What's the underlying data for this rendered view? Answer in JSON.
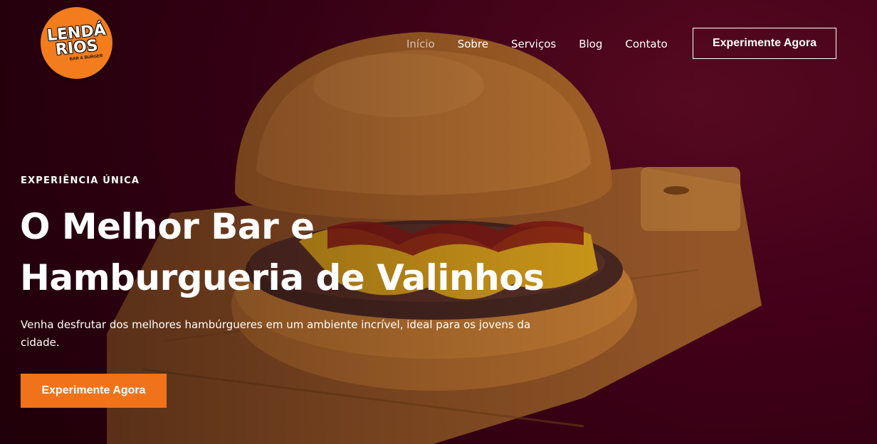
{
  "brand": {
    "logo_line1": "LENDÁ",
    "logo_line2": "RIOS",
    "logo_tagline": "BAR & BURGER",
    "logo_color": "#f37d1c"
  },
  "nav": {
    "items": [
      {
        "label": "Início",
        "active": true
      },
      {
        "label": "Sobre",
        "active": false
      },
      {
        "label": "Serviços",
        "active": false
      },
      {
        "label": "Blog",
        "active": false
      },
      {
        "label": "Contato",
        "active": false
      }
    ],
    "cta_label": "Experimente Agora"
  },
  "hero": {
    "eyebrow": "EXPERIÊNCIA ÚNICA",
    "headline_line1": "O Melhor Bar e",
    "headline_line2": "Hamburgueria de Valinhos",
    "subtext": "Venha desfrutar dos melhores hambúrgueres em um ambiente incrível, ideal para os jovens da cidade.",
    "cta_label": "Experimente Agora",
    "cta_color": "#f0731b",
    "background_color": "#45001a"
  }
}
